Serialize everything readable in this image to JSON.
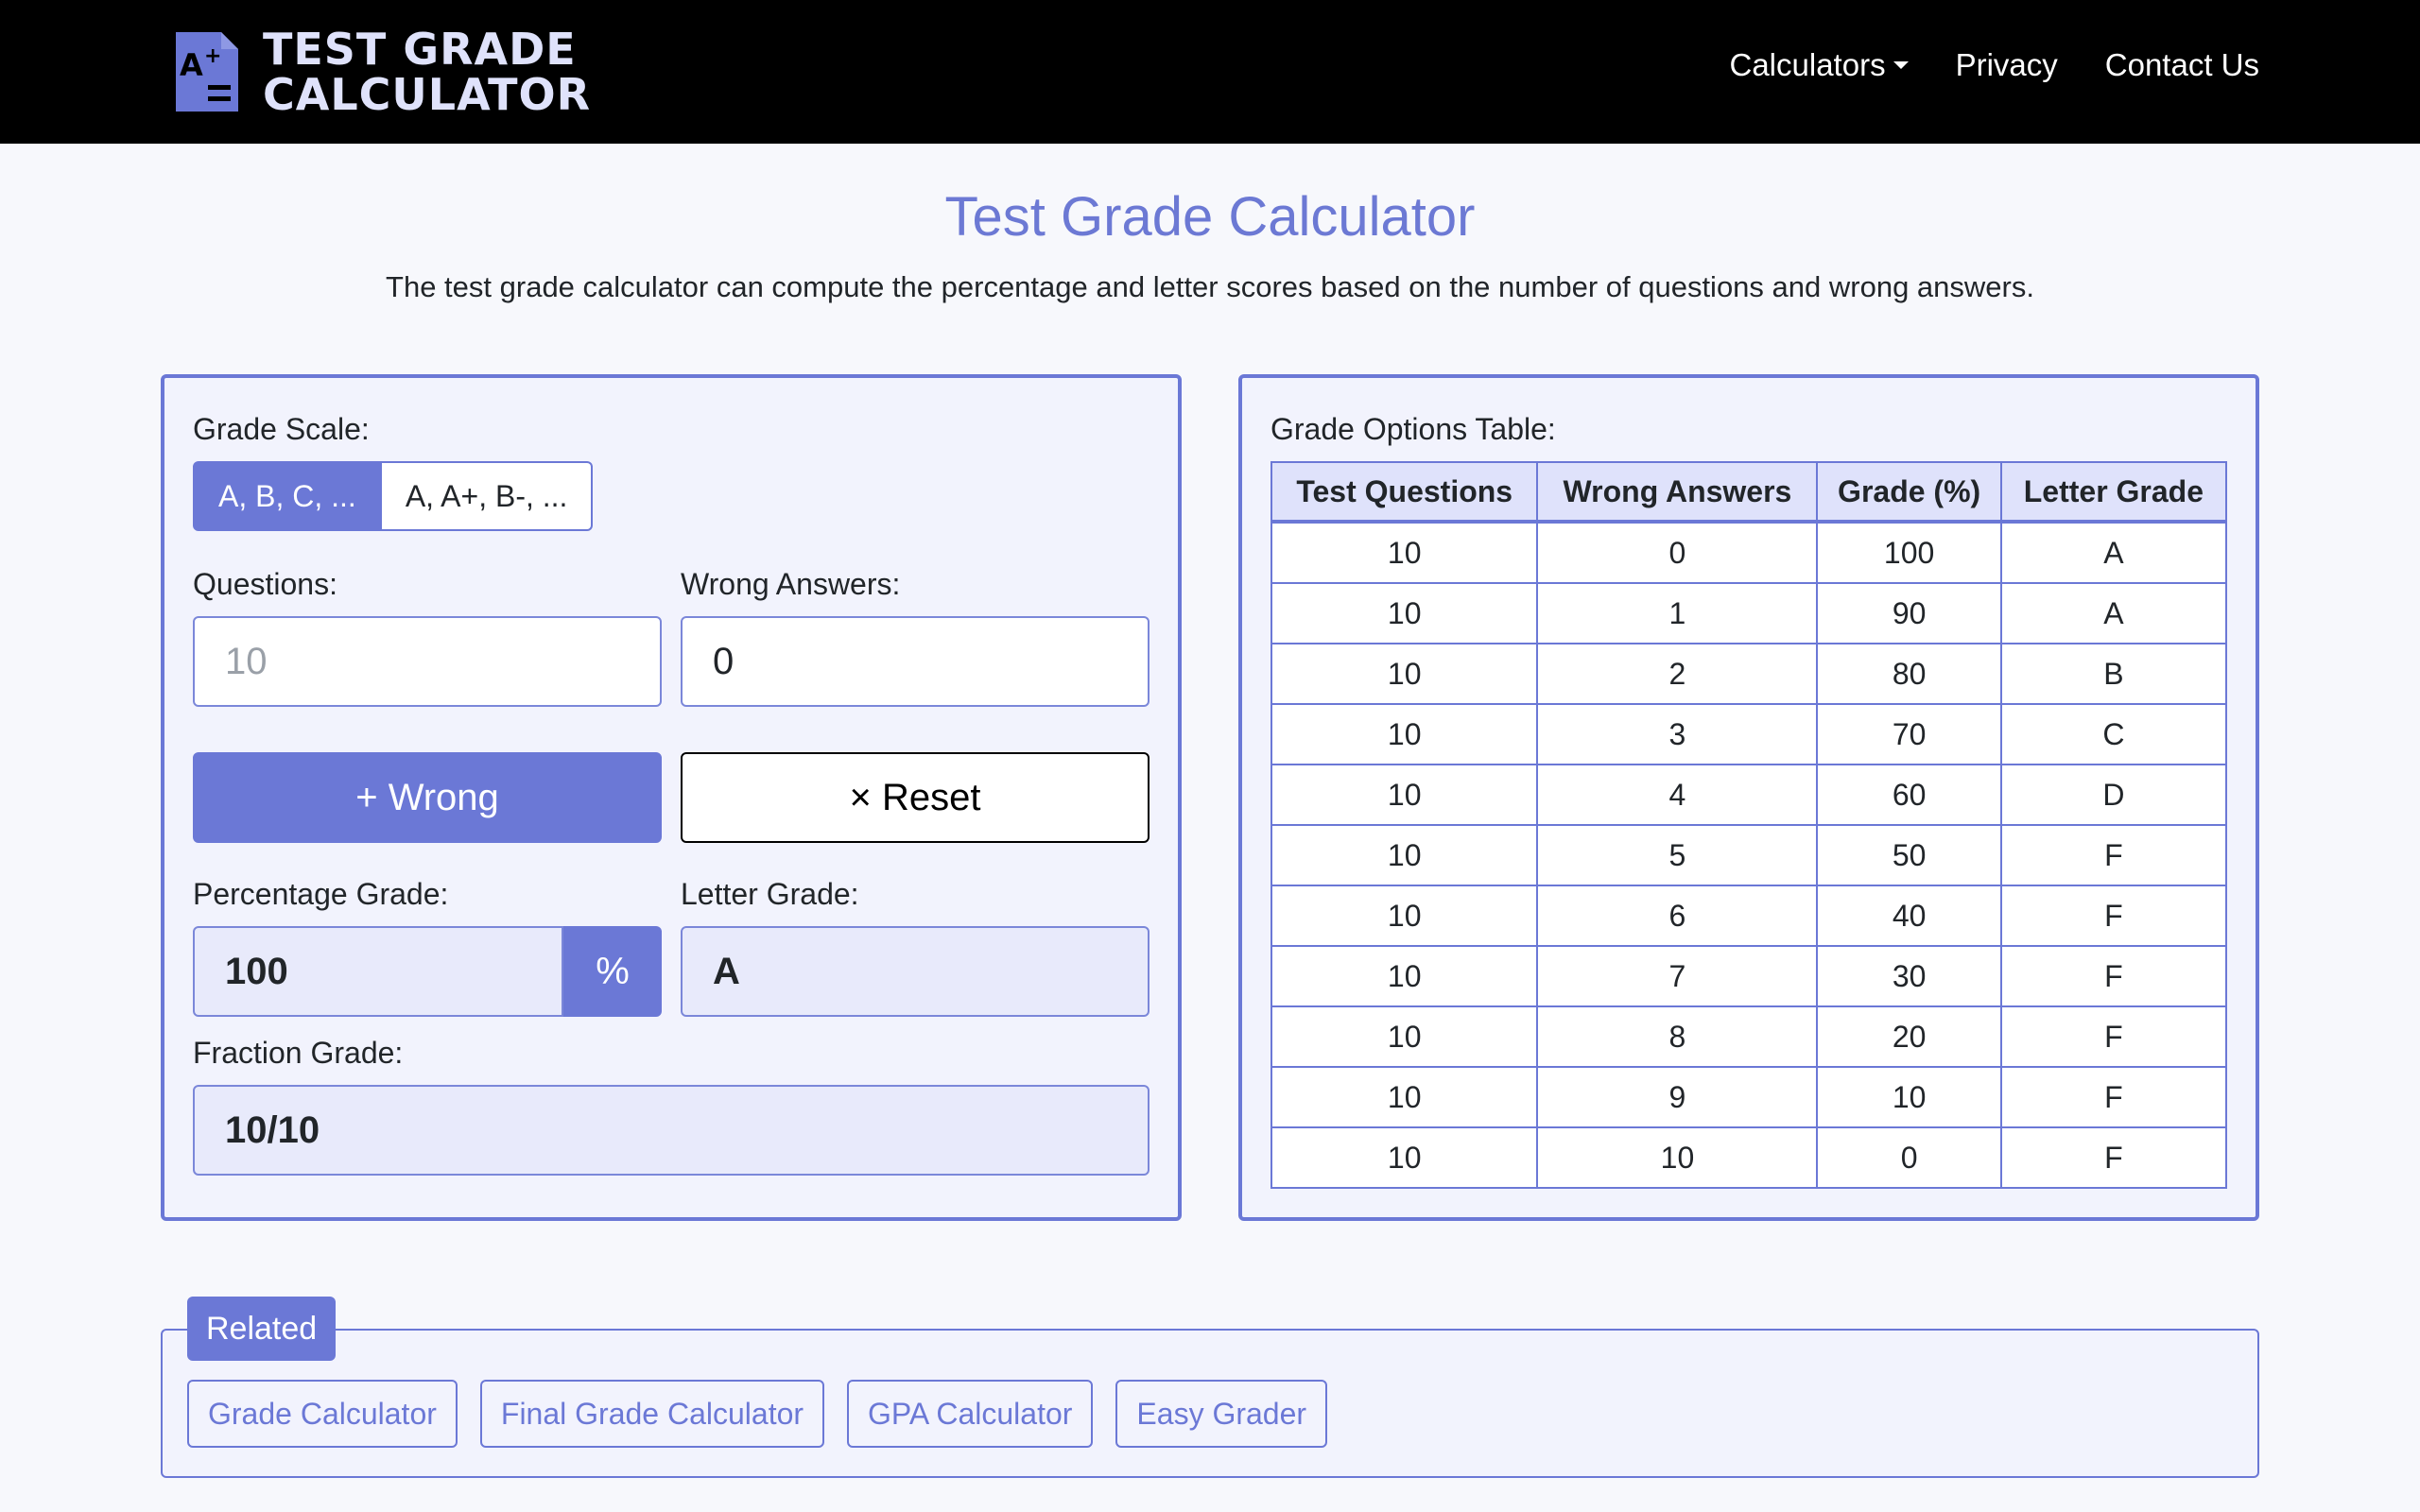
{
  "nav": {
    "logo_line1": "TEST GRADE",
    "logo_line2": "CALCULATOR",
    "links": [
      "Calculators",
      "Privacy",
      "Contact Us"
    ]
  },
  "header": {
    "title": "Test Grade Calculator",
    "description": "The test grade calculator can compute the percentage and letter scores based on the number of questions and wrong answers."
  },
  "calculator": {
    "grade_scale_label": "Grade Scale:",
    "scale_options": [
      "A, B, C, ...",
      "A, A+, B-, ..."
    ],
    "questions_label": "Questions:",
    "questions_placeholder": "10",
    "wrong_label": "Wrong Answers:",
    "wrong_value": "0",
    "wrong_button": "+ Wrong",
    "reset_button": "× Reset",
    "percentage_label": "Percentage Grade:",
    "percentage_value": "100",
    "percentage_unit": "%",
    "letter_label": "Letter Grade:",
    "letter_value": "A",
    "fraction_label": "Fraction Grade:",
    "fraction_value": "10/10"
  },
  "table": {
    "label": "Grade Options Table:",
    "headers": [
      "Test Questions",
      "Wrong Answers",
      "Grade (%)",
      "Letter Grade"
    ],
    "rows": [
      [
        "10",
        "0",
        "100",
        "A"
      ],
      [
        "10",
        "1",
        "90",
        "A"
      ],
      [
        "10",
        "2",
        "80",
        "B"
      ],
      [
        "10",
        "3",
        "70",
        "C"
      ],
      [
        "10",
        "4",
        "60",
        "D"
      ],
      [
        "10",
        "5",
        "50",
        "F"
      ],
      [
        "10",
        "6",
        "40",
        "F"
      ],
      [
        "10",
        "7",
        "30",
        "F"
      ],
      [
        "10",
        "8",
        "20",
        "F"
      ],
      [
        "10",
        "9",
        "10",
        "F"
      ],
      [
        "10",
        "10",
        "0",
        "F"
      ]
    ]
  },
  "related": {
    "tag": "Related",
    "links": [
      "Grade Calculator",
      "Final Grade Calculator",
      "GPA Calculator",
      "Easy Grader"
    ]
  },
  "colors": {
    "accent": "#6b78d6",
    "title": "#6c79d4",
    "readonly_bg": "#e8eafb",
    "card_bg": "#f2f3fd"
  }
}
